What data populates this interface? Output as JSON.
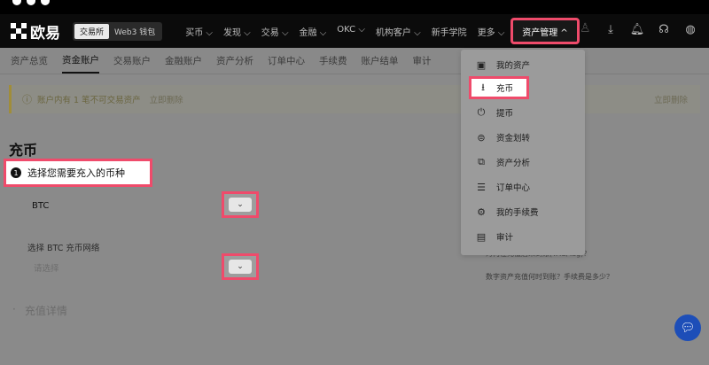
{
  "brand": {
    "name": "欧易"
  },
  "header": {
    "seg_exchange": "交易所",
    "seg_web3": "Web3 钱包",
    "nav": [
      "买币 ⌵",
      "发现 ⌵",
      "交易 ⌵",
      "金融 ⌵",
      "OKC ⌵",
      "机构客户 ⌵",
      "新手学院",
      "更多 ⌵"
    ],
    "asset_mgmt": "资产管理  ^"
  },
  "tabs": [
    "资产总览",
    "资金账户",
    "交易账户",
    "金融账户",
    "资产分析",
    "订单中心",
    "手续费",
    "账户结单",
    "审计"
  ],
  "notice": {
    "text": "账户内有 1 笔不可交易资产",
    "link": "立即删除",
    "right_link": "立即删除"
  },
  "page": {
    "title": "充币",
    "step_num": "1",
    "step_label": "选择您需要充入的币种",
    "coin": "BTC",
    "net_label": "选择 BTC 充币网络",
    "net_placeholder": "请选择",
    "detail_label": "充值详情",
    "faq1": "为何在充值后未到账(TAG/Tag)？",
    "faq2": "数字资产充值何时到账？手续费是多少？"
  },
  "dropdown": {
    "items": [
      {
        "label": "我的资产",
        "icon": "wallet-icon"
      },
      {
        "label": "充币",
        "icon": "deposit-icon"
      },
      {
        "label": "提币",
        "icon": "withdraw-icon"
      },
      {
        "label": "资金划转",
        "icon": "transfer-icon"
      },
      {
        "label": "资产分析",
        "icon": "analysis-icon"
      },
      {
        "label": "订单中心",
        "icon": "orders-icon"
      },
      {
        "label": "我的手续费",
        "icon": "fee-icon"
      },
      {
        "label": "审计",
        "icon": "audit-icon"
      }
    ]
  },
  "colors": {
    "highlight": "#ef4b6b",
    "header_bg": "#0b0b0b",
    "chat": "#1d4eb8"
  }
}
